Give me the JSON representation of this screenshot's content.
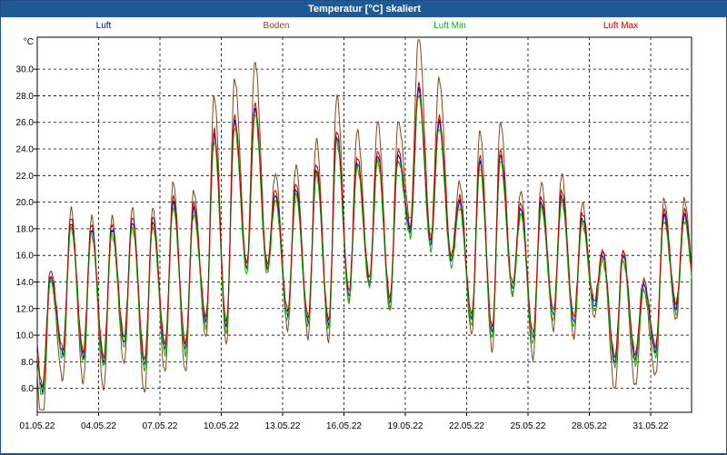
{
  "window": {
    "title": "Temperatur [°C] skaliert"
  },
  "chart_data": {
    "type": "line",
    "title": "Temperatur [°C] skaliert",
    "ylabel": "°C",
    "xlabel": "",
    "ylim": [
      4.2,
      32.4
    ],
    "grid": true,
    "legend_position": "top",
    "x_tick_labels": [
      "01.05.22",
      "04.05.22",
      "07.05.22",
      "10.05.22",
      "13.05.22",
      "16.05.22",
      "19.05.22",
      "22.05.22",
      "25.05.22",
      "28.05.22",
      "31.05.22"
    ],
    "y_tick_labels": [
      "6.0",
      "8.0",
      "10.0",
      "12.0",
      "14.0",
      "16.0",
      "18.0",
      "20.0",
      "22.0",
      "24.0",
      "26.0",
      "28.0",
      "30.0"
    ],
    "y_ticks": [
      6,
      8,
      10,
      12,
      14,
      16,
      18,
      20,
      22,
      24,
      26,
      28,
      30
    ],
    "x_start": "01.05.22",
    "x_end": "01.06.22",
    "daily_min": [
      5.8,
      8.6,
      8.4,
      8.0,
      9.5,
      7.8,
      9.0,
      9.0,
      11.0,
      10.6,
      15.0,
      15.0,
      11.5,
      11.0,
      10.8,
      13.0,
      14.0,
      12.5,
      17.8,
      16.8,
      15.6,
      11.2,
      10.2,
      13.5,
      9.8,
      11.5,
      11.0,
      12.2,
      8.0,
      8.2,
      8.8,
      12.0
    ],
    "daily_max": [
      14.5,
      18.5,
      18.0,
      18.0,
      18.5,
      18.5,
      20.0,
      19.5,
      25.0,
      26.0,
      27.0,
      20.5,
      21.0,
      22.5,
      25.0,
      23.0,
      23.5,
      23.5,
      28.5,
      26.0,
      20.0,
      23.0,
      23.5,
      19.5,
      20.0,
      20.5,
      18.8,
      16.0,
      16.0,
      13.8,
      19.0,
      19.0
    ],
    "series": [
      {
        "name": "Luft",
        "color": "#0000cc",
        "offset": 0.0,
        "amp": 1.0
      },
      {
        "name": "Boden",
        "color": "#8b4513",
        "offset": 0.0,
        "amp": 1.3
      },
      {
        "name": "Luft Min",
        "color": "#00bb00",
        "offset": -0.4,
        "amp": 1.0
      },
      {
        "name": "Luft Max",
        "color": "#c00000",
        "offset": 0.4,
        "amp": 1.0
      }
    ]
  }
}
